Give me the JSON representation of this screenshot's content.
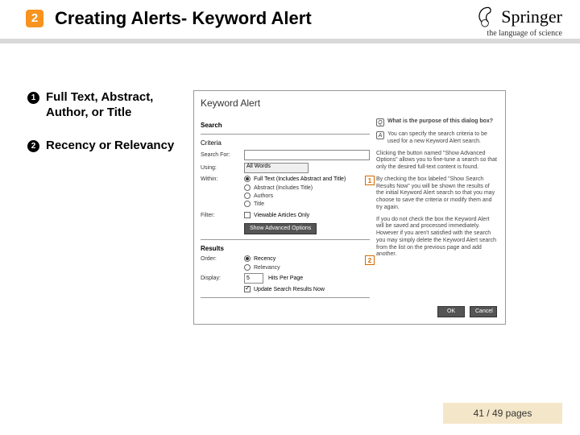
{
  "header": {
    "badge": "2",
    "title": "Creating Alerts- Keyword Alert"
  },
  "brand": {
    "name": "Springer",
    "tagline": "the language of science"
  },
  "bullets": [
    {
      "num": "1",
      "text": "Full Text, Abstract, Author, or Title"
    },
    {
      "num": "2",
      "text": "Recency or Relevancy"
    }
  ],
  "dialog": {
    "title": "Keyword Alert",
    "search_heading": "Search",
    "criteria_heading": "Criteria",
    "search_for_label": "Search For:",
    "search_for_value": "",
    "using_label": "Using:",
    "using_value": "All Words",
    "within_label": "Within:",
    "within_options": [
      "Full Text (Includes Abstract and Title)",
      "Abstract (Includes Title)",
      "Authors",
      "Title"
    ],
    "within_selected_index": 0,
    "filter_label": "Filter:",
    "filter_checkbox": "Viewable Articles Only",
    "adv_button": "Show Advanced Options",
    "results_heading": "Results",
    "order_label": "Order:",
    "order_options": [
      "Recency",
      "Relevancy"
    ],
    "order_selected_index": 0,
    "display_label": "Display:",
    "display_value": "5",
    "display_suffix": "Hits Per Page",
    "update_checkbox": "Update Search Results Now",
    "ok": "OK",
    "cancel": "Cancel",
    "help": {
      "q": "What is the purpose of this dialog box?",
      "a": "You can specify the search criteria to be used for a new Keyword Alert search.",
      "p1": "Clicking the button named \"Show Advanced Options\" allows you to fine-tune a search so that only the desired full-text content is found.",
      "p2": "By checking the box labeled \"Show Search Results Now\" you will be shown the results of the initial Keyword Alert search so that you may choose to save the criteria or modify them and try again.",
      "p3": "If you do not check the box the Keyword Alert will be saved and processed immediately. However if you aren't satisfied with the search you may simply delete the Keyword Alert search from the list on the previous page and add another."
    }
  },
  "callouts": {
    "one": "1",
    "two": "2"
  },
  "footer": "41 / 49 pages"
}
